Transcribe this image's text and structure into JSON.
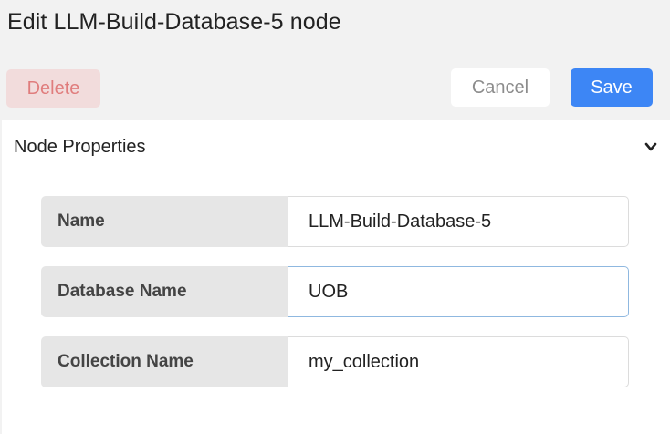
{
  "dialog": {
    "title": "Edit LLM-Build-Database-5 node"
  },
  "toolbar": {
    "delete_label": "Delete",
    "cancel_label": "Cancel",
    "save_label": "Save"
  },
  "panel": {
    "header": "Node Properties",
    "toggle_icon": "chevron-down-icon",
    "fields": [
      {
        "label": "Name",
        "value": "LLM-Build-Database-5"
      },
      {
        "label": "Database Name",
        "value": "UOB"
      },
      {
        "label": "Collection Name",
        "value": "my_collection"
      }
    ]
  },
  "colors": {
    "save": "#3d86f5",
    "delete_bg": "#f2dcdc",
    "delete_text": "#e07d7d"
  }
}
